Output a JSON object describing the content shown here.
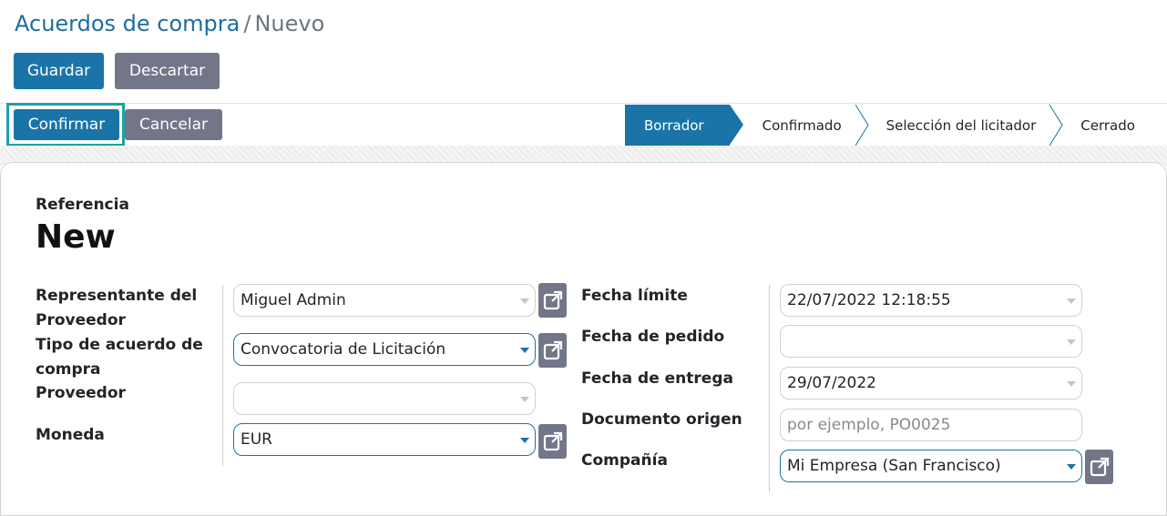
{
  "breadcrumb": {
    "parent": "Acuerdos de compra",
    "separator": "/",
    "current": "Nuevo"
  },
  "actions": {
    "save": "Guardar",
    "discard": "Descartar"
  },
  "workflow": {
    "confirm": "Confirmar",
    "cancel": "Cancelar"
  },
  "statusbar": {
    "stages": [
      "Borrador",
      "Confirmado",
      "Selección del licitador",
      "Cerrado"
    ],
    "active": "Borrador"
  },
  "form": {
    "reference_label": "Referencia",
    "reference_value": "New",
    "left": {
      "representative_label_1": "Representante del",
      "representative_label_2": "Proveedor",
      "representative_value": "Miguel Admin",
      "agreement_type_label_1": "Tipo de acuerdo de",
      "agreement_type_label_2": "compra",
      "agreement_type_value": "Convocatoria de Licitación",
      "vendor_label": "Proveedor",
      "vendor_value": "",
      "currency_label": "Moneda",
      "currency_value": "EUR"
    },
    "right": {
      "deadline_label": "Fecha límite",
      "deadline_value": "22/07/2022 12:18:55",
      "order_date_label": "Fecha de pedido",
      "order_date_value": "",
      "delivery_date_label": "Fecha de entrega",
      "delivery_date_value": "29/07/2022",
      "source_doc_label": "Documento origen",
      "source_doc_placeholder": "por ejemplo, PO0025",
      "company_label": "Compañía",
      "company_value": "Mi Empresa (San Francisco)"
    }
  },
  "colors": {
    "primary": "#1b74a8",
    "secondary": "#737689",
    "highlight": "#1aa3a3",
    "breadcrumb_link": "#1f6d9c"
  },
  "icons": {
    "external_link": "external-link-icon",
    "dropdown": "caret-down-icon"
  }
}
